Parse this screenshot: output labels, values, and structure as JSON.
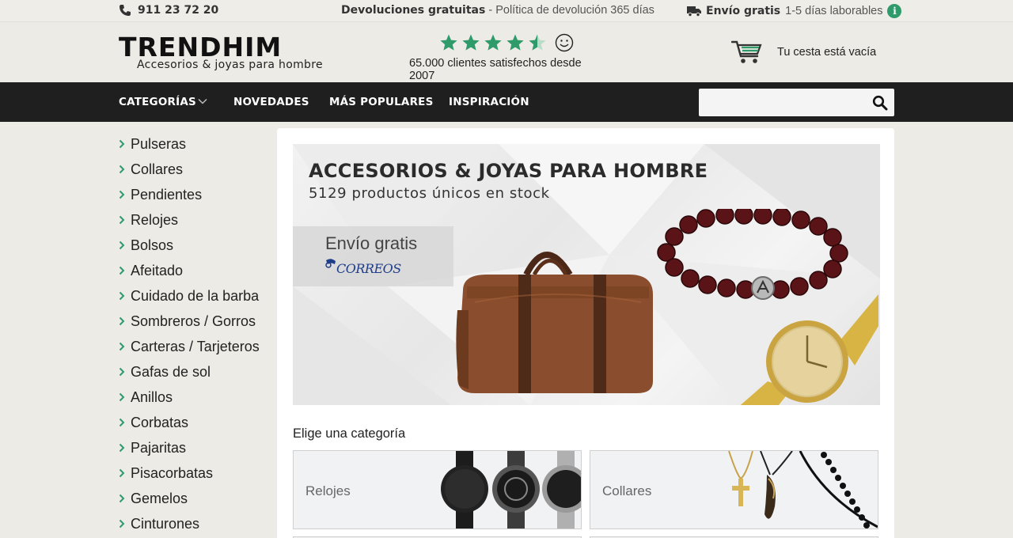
{
  "topbar": {
    "phone": "911 23 72 20",
    "returns_bold": "Devoluciones gratuitas",
    "returns_rest": " - Política de devolución 365 días",
    "shipping_bold": "Envío gratis",
    "shipping_rest": "1-5 días laborables",
    "info_icon_glyph": "i"
  },
  "header": {
    "logo_wordmark": "TRENDHIM",
    "logo_tagline": "Accesorios & joyas para hombre",
    "rating_value": 4.5,
    "rating_max": 5,
    "clients_text": "65.000 clientes satisfechos desde 2007",
    "cart_text": "Tu cesta está vacía",
    "accent_color": "#2f9a6a"
  },
  "nav": {
    "items": [
      "CATEGORÍAS",
      "NOVEDADES",
      "MÁS POPULARES",
      "INSPIRACIÓN"
    ],
    "search_placeholder": ""
  },
  "sidebar": {
    "categories": [
      "Pulseras",
      "Collares",
      "Pendientes",
      "Relojes",
      "Bolsos",
      "Afeitado",
      "Cuidado de la barba",
      "Sombreros / Gorros",
      "Carteras / Tarjeteros",
      "Gafas de sol",
      "Anillos",
      "Corbatas",
      "Pajaritas",
      "Pisacorbatas",
      "Gemelos",
      "Cinturones"
    ]
  },
  "hero": {
    "title": "ACCESORIOS & JOYAS PARA HOMBRE",
    "subtitle": "5129 productos únicos en stock",
    "shipping_title": "Envío gratis",
    "carrier": "CORREOS"
  },
  "main": {
    "section_title": "Elige una categoría",
    "tiles": [
      {
        "label": "Relojes"
      },
      {
        "label": "Collares"
      }
    ]
  }
}
